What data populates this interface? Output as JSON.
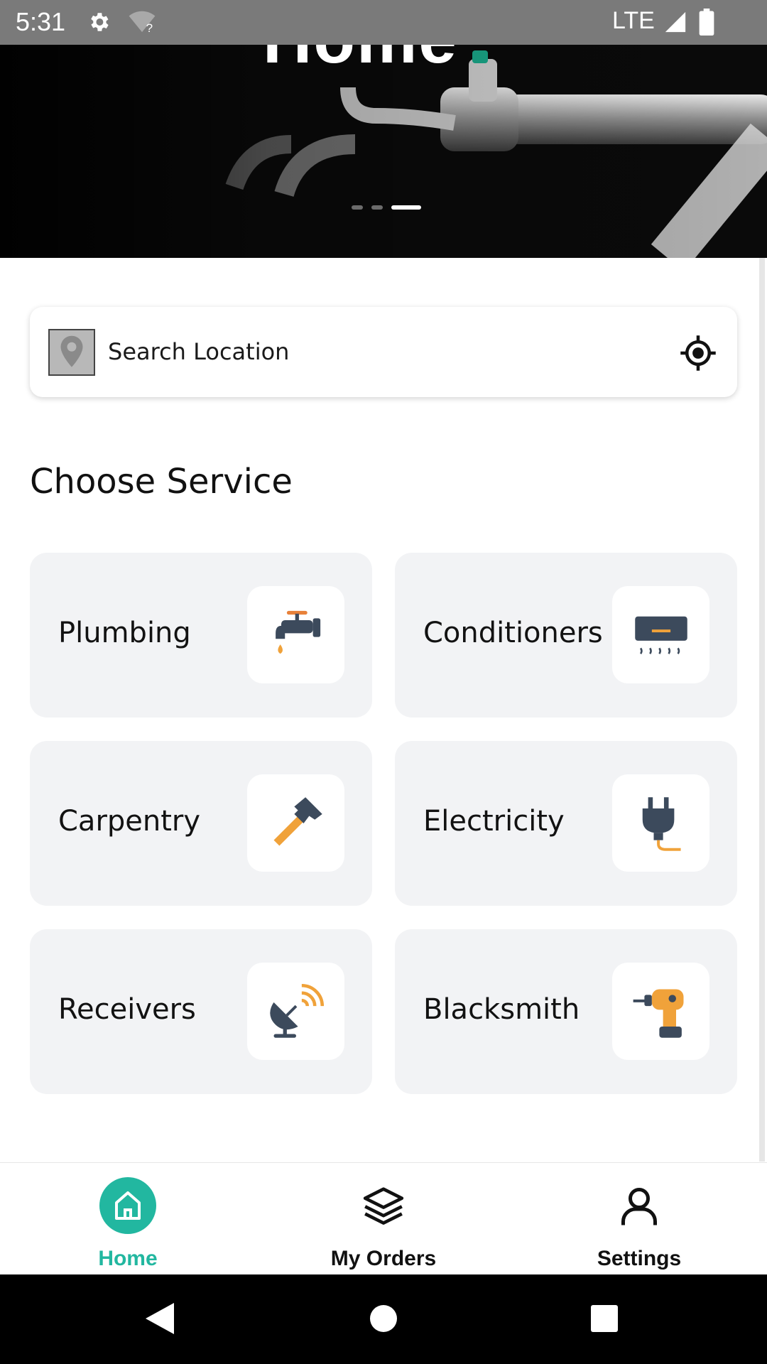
{
  "status_bar": {
    "time": "5:31",
    "network": "LTE"
  },
  "hero": {
    "headline": "Home"
  },
  "search": {
    "placeholder": "Search Location"
  },
  "section_title": "Choose Service",
  "services": [
    {
      "label": "Plumbing",
      "icon": "faucet-icon"
    },
    {
      "label": "Conditioners",
      "icon": "air-conditioner-icon"
    },
    {
      "label": "Carpentry",
      "icon": "hammer-icon"
    },
    {
      "label": "Electricity",
      "icon": "plug-icon"
    },
    {
      "label": "Receivers",
      "icon": "satellite-dish-icon"
    },
    {
      "label": "Blacksmith",
      "icon": "drill-icon"
    }
  ],
  "bottom_nav": {
    "items": [
      {
        "label": "Home",
        "icon": "home-icon",
        "active": true
      },
      {
        "label": "My Orders",
        "icon": "layers-icon",
        "active": false
      },
      {
        "label": "Settings",
        "icon": "user-icon",
        "active": false
      }
    ]
  },
  "colors": {
    "accent": "#22b7a0",
    "card_bg": "#f2f3f5",
    "status_bar": "#7a7a7a"
  }
}
